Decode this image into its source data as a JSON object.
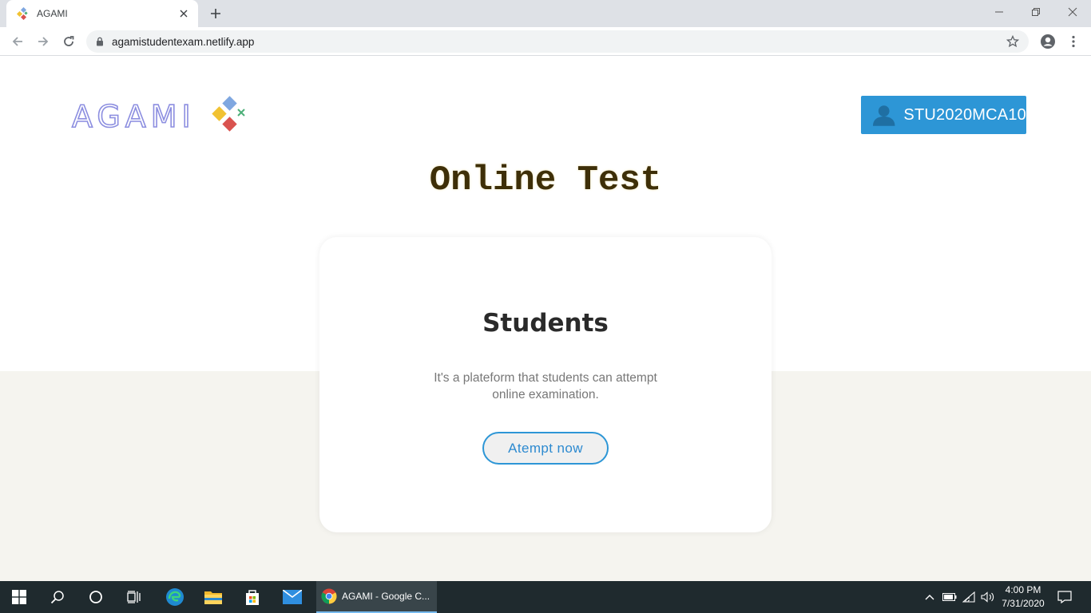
{
  "browser": {
    "tab_title": "AGAMI",
    "tab_favicon": "agami-favicon-icon",
    "url": "agamistudentexam.netlify.app"
  },
  "header": {
    "logo_text": "AGAMI",
    "user_id": "STU2020MCA10"
  },
  "main": {
    "title": "Online Test",
    "card": {
      "heading": "Students",
      "description": "It's a plateform that students can attempt online examination.",
      "button_label": "Atempt now"
    }
  },
  "taskbar": {
    "active_app_label": "AGAMI - Google C...",
    "time": "4:00 PM",
    "date": "7/31/2020"
  },
  "colors": {
    "accent": "#2d96d6",
    "title": "#3e2f08",
    "lower_bg": "#f5f4ef",
    "taskbar": "#1f2a2e"
  }
}
